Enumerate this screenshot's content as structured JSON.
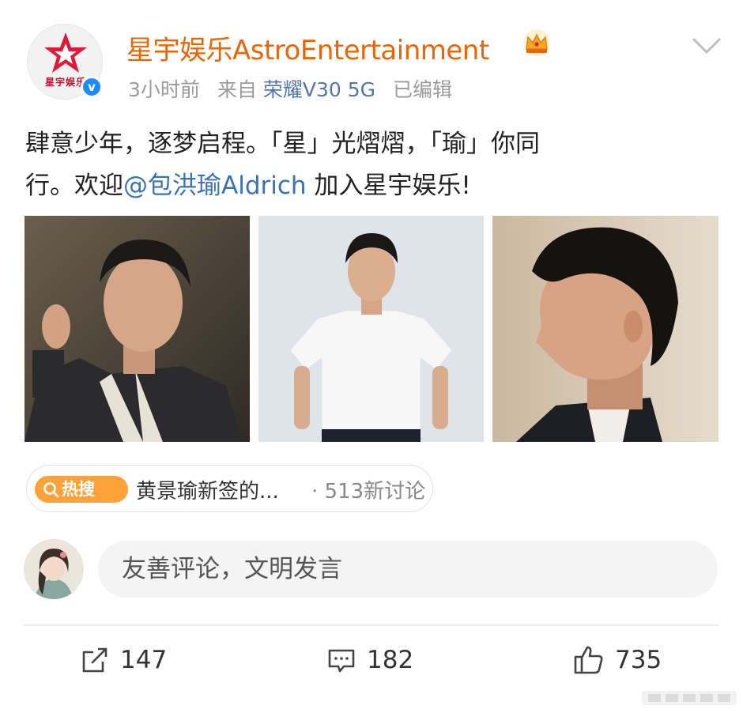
{
  "post": {
    "author": {
      "name": "星宇娱乐AstroEntertainment",
      "avatar_logo_text": "星宇娱乐",
      "verified_mark": "v",
      "badge_icon": "crown-icon"
    },
    "meta": {
      "time": "3小时前",
      "source_prefix": "来自",
      "device": "荣耀V30 5G",
      "edited": "已编辑"
    },
    "text_line1": "肆意少年，逐梦启程。「星」光熠熠，「瑜」你同",
    "text_line2_prefix": "行。欢迎",
    "mention": "@包洪瑜Aldrich",
    "text_line2_suffix": " 加入星宇娱乐!",
    "images": [
      {
        "icon": "photo-portrait-dark-suit"
      },
      {
        "icon": "photo-white-tshirt"
      },
      {
        "icon": "photo-profile-side"
      }
    ]
  },
  "hot_search": {
    "badge_label": "热搜",
    "title": "黄景瑜新签的...",
    "separator": "·",
    "discussion": "513新讨论"
  },
  "comment_box": {
    "placeholder": "友善评论，文明发言"
  },
  "actions": {
    "repost_count": "147",
    "comment_count": "182",
    "like_count": "735"
  },
  "colors": {
    "username": "#e8660a",
    "link": "#3a72b5",
    "device": "#5476a8",
    "hot_badge": "#ffa23a",
    "verified": "#1a8cff"
  }
}
